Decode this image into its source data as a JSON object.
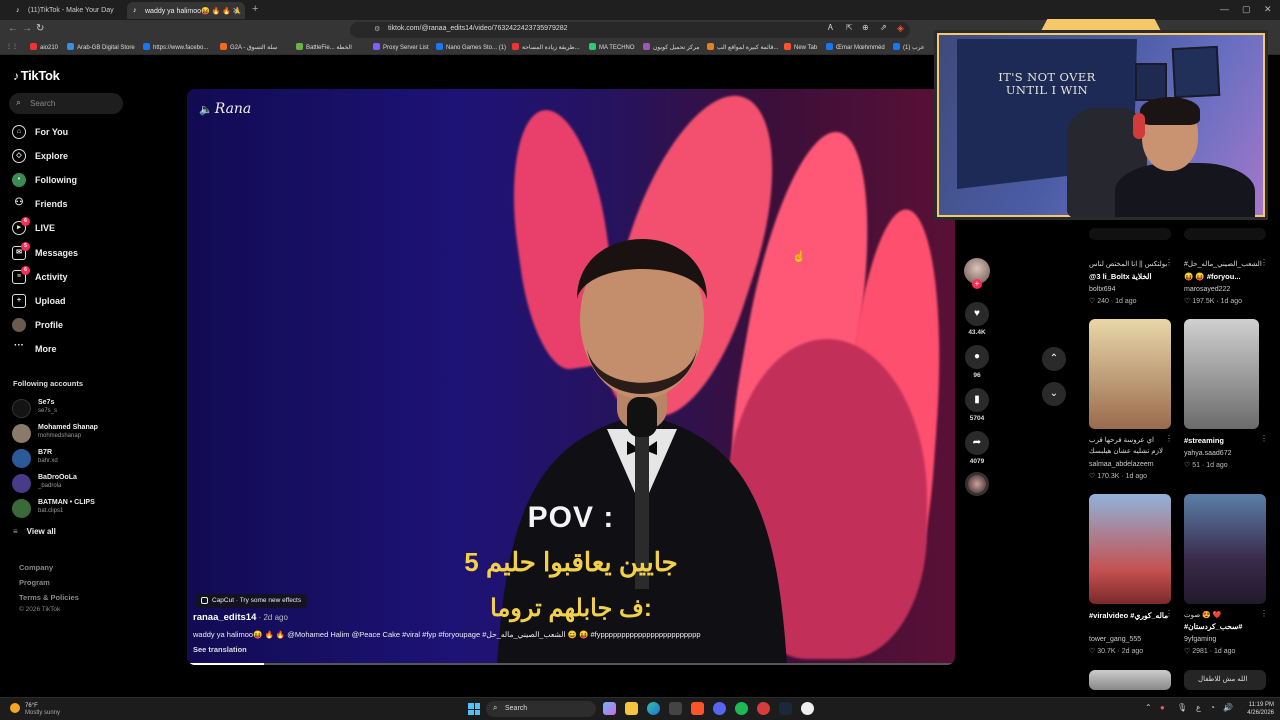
{
  "browser": {
    "tabs": [
      {
        "title": "(11)TikTok - Make Your Day"
      },
      {
        "title": "waddy ya halimoo😝 🔥 🔥 🙏"
      }
    ],
    "url": "tiktok.com/@ranaa_edits14/video/7632422423735979282",
    "bookmarks": [
      "aio210",
      "Arab-GB Digital Store",
      "https://www.facebo...",
      "G2A - سلة التسوق",
      "BattleFie... الخطة",
      "Proxy Server List",
      "Nano Games Sto... (1)",
      "طريقة زيادة المساحة...",
      "MA TECHNO",
      "مركز تحميل كوبون",
      "قائمة كبيرة لمواقع الب...",
      "New Tab",
      "Œmar Mœhmméd",
      "(1) عرب"
    ]
  },
  "sidebar": {
    "logo": "TikTok",
    "search_placeholder": "Search",
    "nav": [
      {
        "label": "For You",
        "icon": "home-icon"
      },
      {
        "label": "Explore",
        "icon": "compass-icon"
      },
      {
        "label": "Following",
        "icon": "following-icon"
      },
      {
        "label": "Friends",
        "icon": "friends-icon"
      },
      {
        "label": "LIVE",
        "icon": "live-icon",
        "badge": "6"
      },
      {
        "label": "Messages",
        "icon": "messages-icon",
        "badge": "5"
      },
      {
        "label": "Activity",
        "icon": "activity-icon",
        "badge": "6"
      },
      {
        "label": "Upload",
        "icon": "upload-icon"
      },
      {
        "label": "Profile",
        "icon": "profile-icon"
      },
      {
        "label": "More",
        "icon": "more-icon"
      }
    ],
    "following_header": "Following accounts",
    "following": [
      {
        "name": "Se7s",
        "handle": "se7s_s",
        "color": "#1a1a1a"
      },
      {
        "name": "Mohamed Shanap",
        "handle": "mohmedshanap",
        "color": "#8a7a6a"
      },
      {
        "name": "B7R",
        "handle": "bahr.xd",
        "color": "#2a5a9a"
      },
      {
        "name": "BaDroOoLa",
        "handle": "_badrola",
        "color": "#4a3a8a"
      },
      {
        "name": "BATMAN • CLIPS",
        "handle": "bat.clips1",
        "color": "#3a6a3a"
      }
    ],
    "view_all": "View all",
    "footer": [
      "Company",
      "Program",
      "Terms & Policies",
      "© 2026 TikTok"
    ]
  },
  "video": {
    "watermark": "Rana",
    "pov": "POV :",
    "caption_line1": "5 جايين يعاقبوا حليم",
    "caption_line2": "ف جابلهم تروما:",
    "capcut": "CapCut · Try some new effects",
    "author": "ranaa_edits14",
    "posted": " · 2d ago",
    "description": "waddy ya halimoo😝 🔥 🔥 @Mohamed Halim @Peace Cake #viral #fyp #foryoupage #الشعب_الصيني_ماله_حل 😄 😝 #fypppppppppppppppppppppppp",
    "see_translation": "See translation",
    "progress": 0.1
  },
  "actions": {
    "likes": "43.4K",
    "comments": "96",
    "saves": "5704",
    "shares": "4079"
  },
  "webcam": {
    "banner_text_1": "IT'S NOT OVER",
    "banner_text_2": "UNTIL I WIN"
  },
  "recommendations": [
    {
      "line1": "بولتكس || انا المختص لناس",
      "line2": "@3 li_Boltx الخلاية",
      "author": "boltx694",
      "stats": "♡ 240 · 1d ago",
      "colors": [
        "#222",
        "#444"
      ]
    },
    {
      "line1": "#الشعب_الصيني_ماله_حل",
      "line2": "😝 😝 #foryou...",
      "author": "marosayed222",
      "stats": "♡ 197.5K · 1d ago",
      "colors": [
        "#222",
        "#444"
      ]
    },
    {
      "line1": "اي عروسة فرحها قرب",
      "line2": "لازم تشليه عشان هيلبسك",
      "author": "salmaa_abdelazeem",
      "stats": "♡ 170.3K · 1d ago",
      "colors": [
        "#e8d7a8",
        "#b57b4a"
      ]
    },
    {
      "line1": "",
      "line2": "#streaming",
      "author": "yahya.saad672",
      "stats": "♡ 51 · 1d ago",
      "colors": [
        "#c9c9c9",
        "#6b6b6b"
      ]
    },
    {
      "line1": "",
      "line2": "#viralvideo #ماله_كوري",
      "author": "tower_gang_555",
      "stats": "♡ 30.7K · 2d ago",
      "colors": [
        "#8fb3d9",
        "#a33b3b"
      ]
    },
    {
      "line1": "صوت 😍 ❤️",
      "line2": "#سحب_كردستان#",
      "author": "9yfgaming",
      "stats": "♡ 2981 · 1d ago",
      "colors": [
        "#3a2a4a",
        "#6a9abb"
      ]
    },
    {
      "line1": "",
      "line2": "",
      "author": "",
      "stats": "",
      "colors": [
        "#bbb",
        "#888"
      ]
    },
    {
      "line1": "الله مش للاطفال",
      "line2": "",
      "author": "",
      "stats": "",
      "colors": [
        "#2a2a2a",
        "#555"
      ]
    }
  ],
  "taskbar": {
    "weather_temp": "76°F",
    "weather_desc": "Mostly sunny",
    "search": "Search",
    "time": "11:19 PM",
    "date": "4/26/2026"
  }
}
